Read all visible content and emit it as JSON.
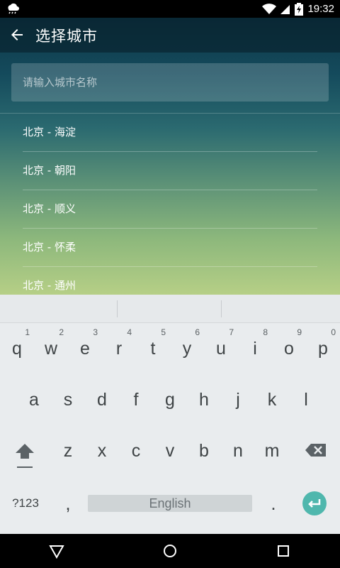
{
  "status_bar": {
    "time": "19:32",
    "battery_level": 0.85,
    "left_icon": "weather-rain-icon"
  },
  "toolbar": {
    "title": "选择城市",
    "back_icon": "arrow-back-icon"
  },
  "search": {
    "placeholder": "请输入城市名称",
    "value": ""
  },
  "cities": [
    "北京 - 海淀",
    "北京 - 朝阳",
    "北京 - 顺义",
    "北京 - 怀柔",
    "北京 - 通州"
  ],
  "keyboard": {
    "row1": [
      {
        "char": "q",
        "hint": "1"
      },
      {
        "char": "w",
        "hint": "2"
      },
      {
        "char": "e",
        "hint": "3"
      },
      {
        "char": "r",
        "hint": "4"
      },
      {
        "char": "t",
        "hint": "5"
      },
      {
        "char": "y",
        "hint": "6"
      },
      {
        "char": "u",
        "hint": "7"
      },
      {
        "char": "i",
        "hint": "8"
      },
      {
        "char": "o",
        "hint": "9"
      },
      {
        "char": "p",
        "hint": "0"
      }
    ],
    "row2": [
      "a",
      "s",
      "d",
      "f",
      "g",
      "h",
      "j",
      "k",
      "l"
    ],
    "row3": [
      "z",
      "x",
      "c",
      "v",
      "b",
      "n",
      "m"
    ],
    "symbols_label": "?123",
    "comma": ",",
    "space_label": "English",
    "period": ".",
    "accent_color": "#4fb7ad"
  },
  "colors": {
    "gradient_top": "#0f3847",
    "gradient_bottom": "#b6cf86",
    "keyboard_bg": "#e9ecee"
  }
}
